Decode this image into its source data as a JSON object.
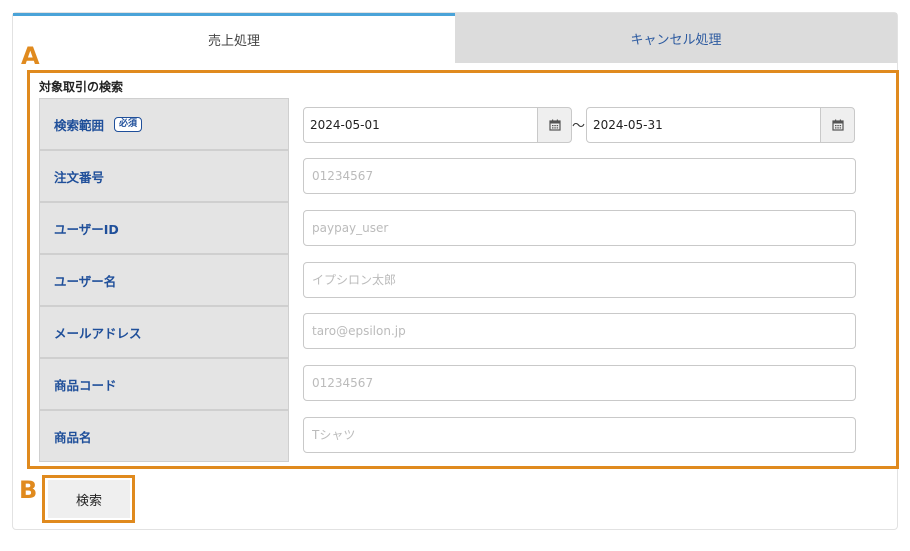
{
  "tabs": [
    {
      "label": "売上処理",
      "active": true
    },
    {
      "label": "キャンセル処理",
      "active": false
    }
  ],
  "annotations": {
    "a": "A",
    "b": "B"
  },
  "section_title": "対象取引の検索",
  "required_badge": "必須",
  "fields": {
    "date_range": {
      "label": "検索範囲",
      "from": "2024-05-01",
      "to": "2024-05-31",
      "separator": "～"
    },
    "order_number": {
      "label": "注文番号",
      "placeholder": "01234567"
    },
    "user_id": {
      "label": "ユーザーID",
      "placeholder": "paypay_user"
    },
    "user_name": {
      "label": "ユーザー名",
      "placeholder": "イプシロン太郎"
    },
    "email": {
      "label": "メールアドレス",
      "placeholder": "taro@epsilon.jp"
    },
    "product_code": {
      "label": "商品コード",
      "placeholder": "01234567"
    },
    "product_name": {
      "label": "商品名",
      "placeholder": "Tシャツ"
    }
  },
  "search_button": "検索",
  "colors": {
    "accent": "#4aa3d8",
    "annotation": "#e08a1e",
    "label_text": "#1f4f9a"
  },
  "icons": {
    "calendar": "calendar-icon"
  }
}
